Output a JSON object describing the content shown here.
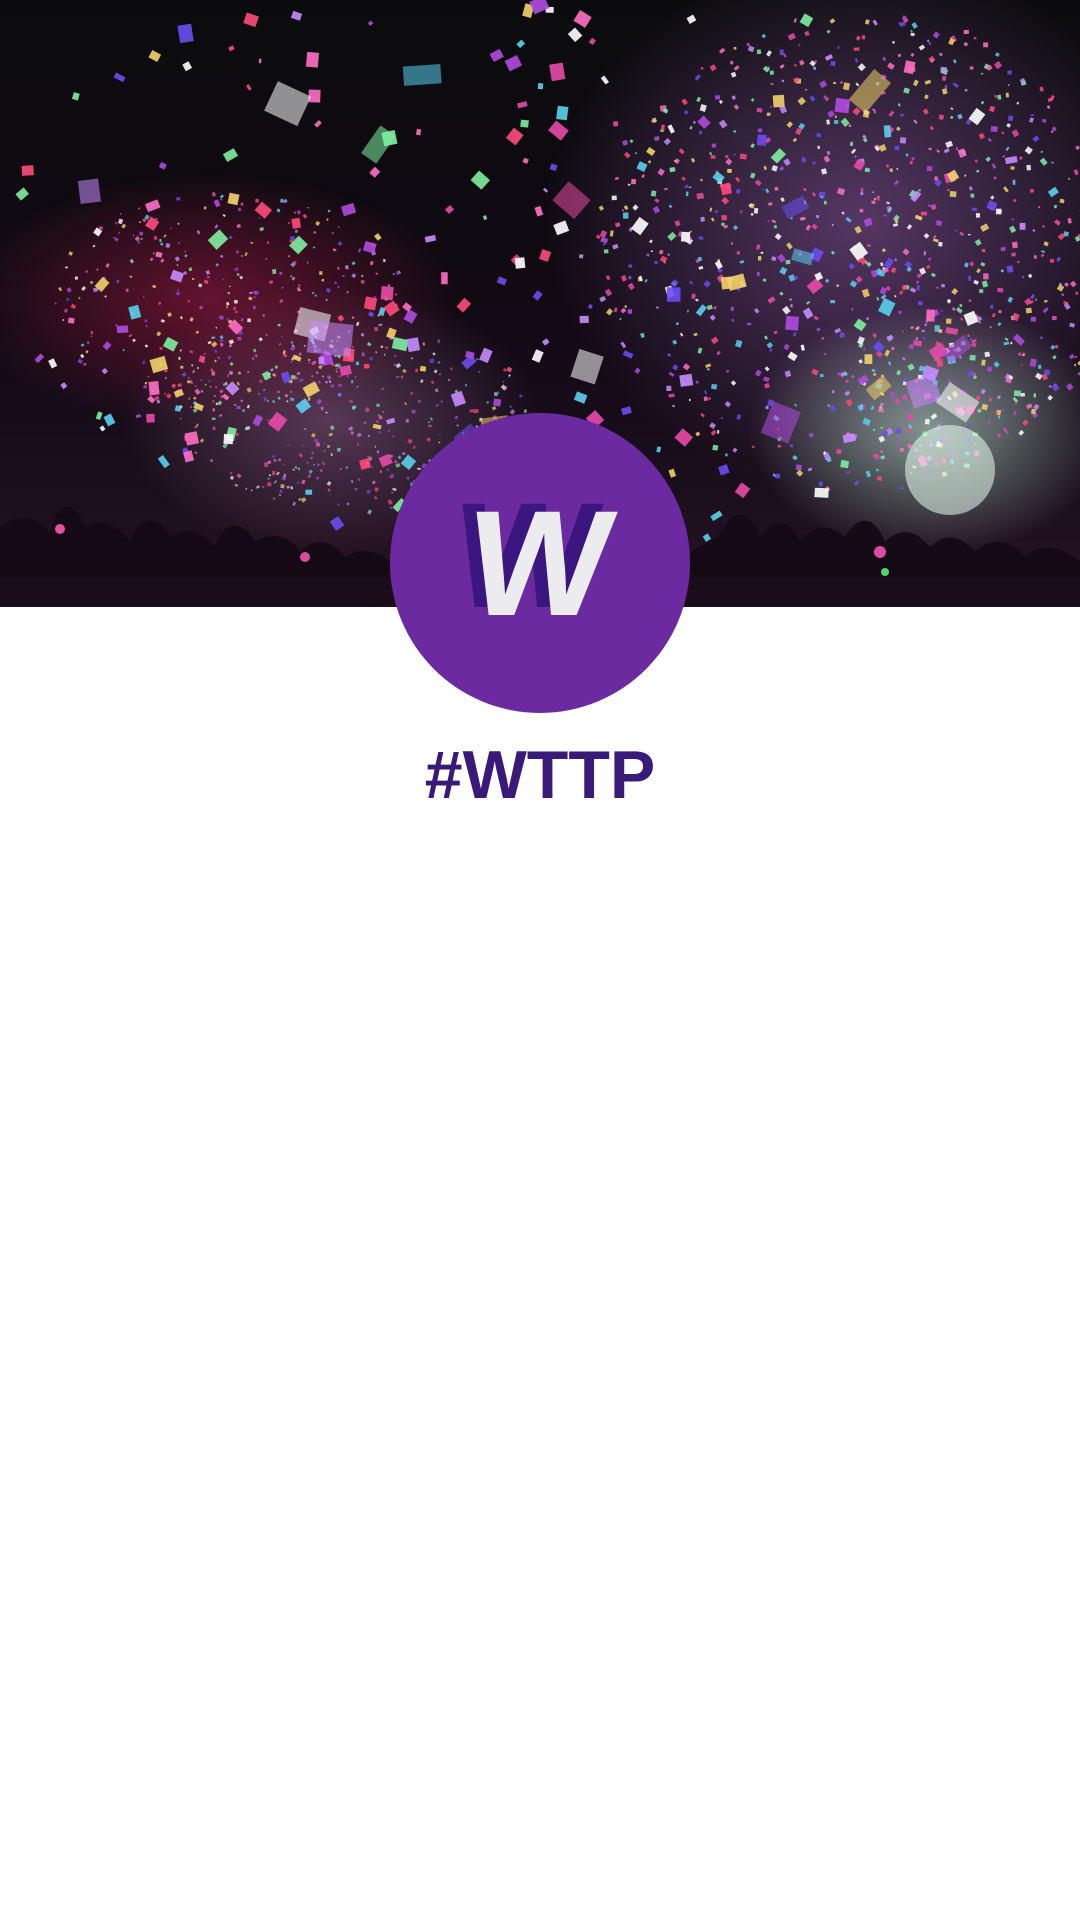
{
  "profile": {
    "title": "#WTTP",
    "avatar_letter": "W",
    "avatar_color": "#6c2aa0",
    "title_color": "#3a1a78"
  },
  "cover": {
    "description_icon": "party-confetti-photo"
  }
}
